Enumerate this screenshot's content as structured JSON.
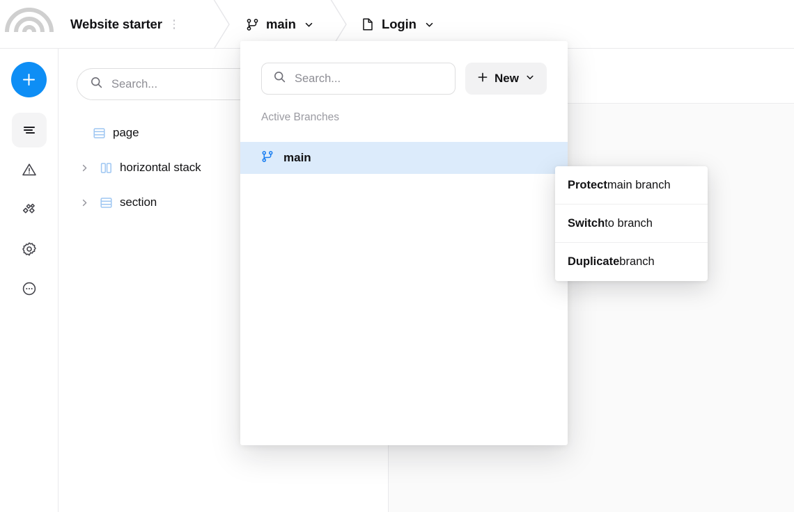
{
  "colors": {
    "accent_blue": "#0e8ef5",
    "branch_icon_blue": "#1a7ef0",
    "row_highlight": "#dcebfb",
    "layer_icon_blue": "#9ec6f2",
    "text": "#121214",
    "muted_text": "#8d8d94",
    "panel_bg": "#ffffff",
    "canvas_gray": "#fafafa"
  },
  "topbar": {
    "logo_name": "rainbow-arcs-logo",
    "document_title": "Website starter",
    "kebab_name": "document-options-icon",
    "breadcrumbs": [
      {
        "icon": "git-branch-icon",
        "label": "main",
        "chevron": "chevron-down-icon"
      },
      {
        "icon": "page-file-icon",
        "label": "Login",
        "chevron": "chevron-down-icon"
      }
    ]
  },
  "rail": {
    "add_button_icon": "plus-icon",
    "items": [
      {
        "icon": "layers-icon",
        "name": "layers",
        "active": true
      },
      {
        "icon": "warning-triangle-icon",
        "name": "issues",
        "active": false
      },
      {
        "icon": "components-diamond-icon",
        "name": "components",
        "active": false
      },
      {
        "icon": "gear-icon",
        "name": "settings",
        "active": false
      },
      {
        "icon": "more-ellipsis-icon",
        "name": "more",
        "active": false
      }
    ]
  },
  "layers_panel": {
    "search": {
      "placeholder": "Search...",
      "value": "",
      "icon": "search-icon"
    },
    "tree": [
      {
        "label": "page",
        "icon": "rows-layout-icon",
        "expandable": false,
        "indent": 0
      },
      {
        "label": "horizontal stack",
        "icon": "columns-layout-icon",
        "expandable": true,
        "indent": 0
      },
      {
        "label": "section",
        "icon": "rows-layout-icon",
        "expandable": true,
        "indent": 0
      }
    ],
    "chevron_icon": "chevron-right-icon"
  },
  "branch_panel": {
    "search": {
      "placeholder": "Search...",
      "value": "",
      "icon": "search-icon"
    },
    "new_button": {
      "label": "New",
      "plus_icon": "plus-icon",
      "chevron": "chevron-down-icon"
    },
    "section_label": "Active Branches",
    "branches": [
      {
        "label": "main",
        "icon": "git-branch-icon",
        "selected": true
      }
    ]
  },
  "context_menu": {
    "items": [
      {
        "bold": "Protect",
        "rest": " main branch"
      },
      {
        "bold": "Switch",
        "rest": " to branch"
      },
      {
        "bold": "Duplicate",
        "rest": " branch"
      }
    ]
  }
}
